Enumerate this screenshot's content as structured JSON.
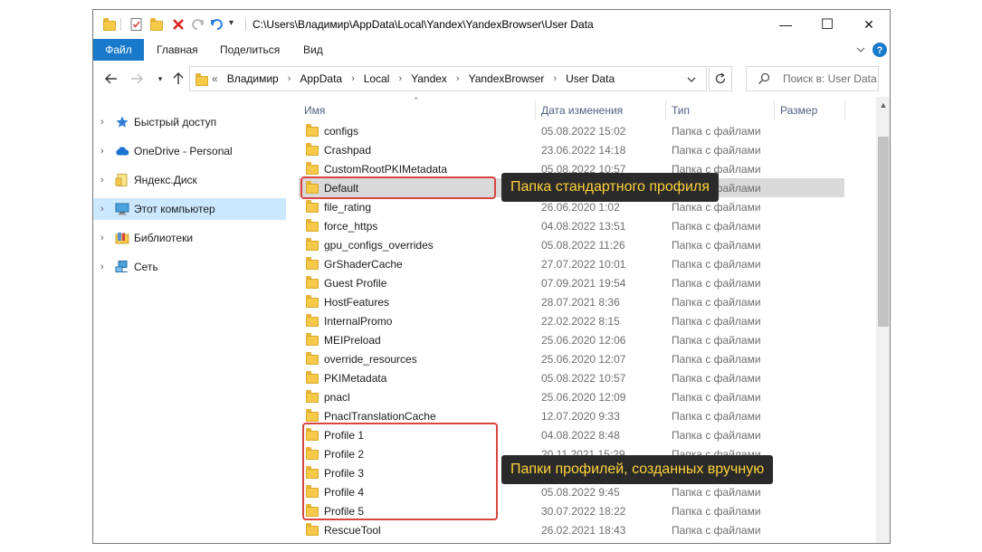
{
  "window": {
    "title": "C:\\Users\\Владимир\\AppData\\Local\\Yandex\\YandexBrowser\\User Data",
    "minimize": "—",
    "maximize": "☐",
    "close": "✕"
  },
  "ribbon": {
    "tabs": [
      "Файл",
      "Главная",
      "Поделиться",
      "Вид"
    ]
  },
  "address": {
    "overflow": "«",
    "crumbs": [
      "Владимир",
      "AppData",
      "Local",
      "Yandex",
      "YandexBrowser",
      "User Data"
    ],
    "separator": "›"
  },
  "search": {
    "placeholder": "Поиск в: User Data"
  },
  "nav": {
    "items": [
      {
        "label": "Быстрый доступ",
        "icon": "star-icon"
      },
      {
        "label": "OneDrive - Personal",
        "icon": "cloud-icon"
      },
      {
        "label": "Яндекс.Диск",
        "icon": "yandex-disk-icon"
      },
      {
        "label": "Этот компьютер",
        "icon": "computer-icon"
      },
      {
        "label": "Библиотеки",
        "icon": "library-icon"
      },
      {
        "label": "Сеть",
        "icon": "network-icon"
      }
    ]
  },
  "columns": {
    "name": "Имя",
    "date": "Дата изменения",
    "type": "Тип",
    "size": "Размер"
  },
  "files": [
    {
      "name": "configs",
      "date": "05.08.2022 15:02",
      "type": "Папка с файлами"
    },
    {
      "name": "Crashpad",
      "date": "23.06.2022 14:18",
      "type": "Папка с файлами"
    },
    {
      "name": "CustomRootPKIMetadata",
      "date": "05.08.2022 10:57",
      "type": "Папка с файлами"
    },
    {
      "name": "Default",
      "date": "",
      "type": "Папка с файлами"
    },
    {
      "name": "file_rating",
      "date": "26.06.2020 1:02",
      "type": "Папка с файлами"
    },
    {
      "name": "force_https",
      "date": "04.08.2022 13:51",
      "type": "Папка с файлами"
    },
    {
      "name": "gpu_configs_overrides",
      "date": "05.08.2022 11:26",
      "type": "Папка с файлами"
    },
    {
      "name": "GrShaderCache",
      "date": "27.07.2022 10:01",
      "type": "Папка с файлами"
    },
    {
      "name": "Guest Profile",
      "date": "07.09.2021 19:54",
      "type": "Папка с файлами"
    },
    {
      "name": "HostFeatures",
      "date": "28.07.2021 8:36",
      "type": "Папка с файлами"
    },
    {
      "name": "InternalPromo",
      "date": "22.02.2022 8:15",
      "type": "Папка с файлами"
    },
    {
      "name": "MEIPreload",
      "date": "25.06.2020 12:06",
      "type": "Папка с файлами"
    },
    {
      "name": "override_resources",
      "date": "25.06.2020 12:07",
      "type": "Папка с файлами"
    },
    {
      "name": "PKIMetadata",
      "date": "05.08.2022 10:57",
      "type": "Папка с файлами"
    },
    {
      "name": "pnacl",
      "date": "25.06.2020 12:09",
      "type": "Папка с файлами"
    },
    {
      "name": "PnaclTranslationCache",
      "date": "12.07.2020 9:33",
      "type": "Папка с файлами"
    },
    {
      "name": "Profile 1",
      "date": "04.08.2022 8:48",
      "type": "Папка с файлами"
    },
    {
      "name": "Profile 2",
      "date": "20.11.2021 15:29",
      "type": "Папка с файлами"
    },
    {
      "name": "Profile 3",
      "date": "",
      "type": "Папка с файлами"
    },
    {
      "name": "Profile 4",
      "date": "05.08.2022 9:45",
      "type": "Папка с файлами"
    },
    {
      "name": "Profile 5",
      "date": "30.07.2022 18:22",
      "type": "Папка с файлами"
    },
    {
      "name": "RescueTool",
      "date": "26.02.2021 18:43",
      "type": "Папка с файлами"
    }
  ],
  "annotations": {
    "default_callout": "Папка стандартного профиля",
    "profiles_callout": "Папки профилей, созданных вручную"
  },
  "colors": {
    "accent": "#1979ca",
    "selection": "#cce8ff",
    "annotation_border": "#d9443f",
    "callout_text": "#ffd23a"
  }
}
